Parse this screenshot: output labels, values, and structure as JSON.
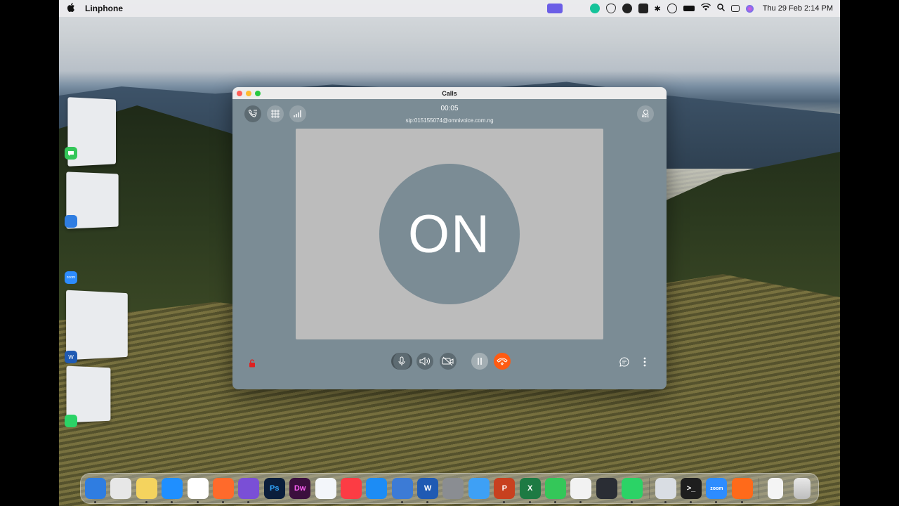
{
  "menubar": {
    "app_name": "Linphone",
    "clock": "Thu 29 Feb  2:14 PM"
  },
  "window": {
    "title": "Calls",
    "timer": "00:05",
    "sip_address": "sip:015155074@omnivoice.com.ng",
    "avatar_initials": "ON",
    "rec_label": "REC"
  },
  "colors": {
    "window_bg": "#7b8c95",
    "video_bg": "#bcbcbc",
    "hangup": "#ff5b12",
    "lock": "#e02020"
  },
  "dock": {
    "apps": [
      {
        "name": "finder-icon",
        "label": "",
        "color": "#2f7de1",
        "running": true
      },
      {
        "name": "launchpad-icon",
        "label": "",
        "color": "#e7e7e7",
        "running": false
      },
      {
        "name": "notes-icon",
        "label": "",
        "color": "#f4d35e",
        "running": true
      },
      {
        "name": "safari-icon",
        "label": "",
        "color": "#1f8fff",
        "running": true
      },
      {
        "name": "chrome-icon",
        "label": "",
        "color": "#ffffff",
        "running": true
      },
      {
        "name": "firefox-icon",
        "label": "",
        "color": "#ff6a2b",
        "running": true
      },
      {
        "name": "tor-icon",
        "label": "",
        "color": "#7a4fd6",
        "running": true
      },
      {
        "name": "photoshop-icon",
        "label": "Ps",
        "color": "#0b1e3b",
        "running": false
      },
      {
        "name": "dreamweaver-icon",
        "label": "Dw",
        "color": "#3b0f3d",
        "running": false
      },
      {
        "name": "freeform-icon",
        "label": "",
        "color": "#f3f6fa",
        "running": false
      },
      {
        "name": "music-icon",
        "label": "",
        "color": "#fc3c44",
        "running": false
      },
      {
        "name": "app-store-icon",
        "label": "",
        "color": "#1c8cf5",
        "running": false
      },
      {
        "name": "xcode-icon",
        "label": "",
        "color": "#3c7bd6",
        "running": true
      },
      {
        "name": "word-icon",
        "label": "W",
        "color": "#1f5ab3",
        "running": true
      },
      {
        "name": "system-settings-icon",
        "label": "",
        "color": "#8a8d92",
        "running": false
      },
      {
        "name": "mail-icon",
        "label": "",
        "color": "#3ea0f5",
        "running": false
      },
      {
        "name": "powerpoint-icon",
        "label": "P",
        "color": "#c8401f",
        "running": true
      },
      {
        "name": "excel-icon",
        "label": "X",
        "color": "#1d7a43",
        "running": true
      },
      {
        "name": "messages-icon",
        "label": "",
        "color": "#34c759",
        "running": true
      },
      {
        "name": "textedit-icon",
        "label": "",
        "color": "#f2f2f2",
        "running": true
      },
      {
        "name": "davinci-icon",
        "label": "",
        "color": "#2a2d34",
        "running": false
      },
      {
        "name": "whatsapp-icon",
        "label": "",
        "color": "#2bd366",
        "running": true
      }
    ],
    "recent": [
      {
        "name": "preview-icon",
        "label": "",
        "color": "#d9dde3",
        "running": true
      },
      {
        "name": "terminal-icon",
        "label": ">_",
        "color": "#1e1e1e",
        "running": true
      },
      {
        "name": "zoom-icon",
        "label": "zoom",
        "color": "#2d8cff",
        "running": true
      },
      {
        "name": "linphone-icon",
        "label": "",
        "color": "#ff6a1a",
        "running": true
      }
    ]
  }
}
